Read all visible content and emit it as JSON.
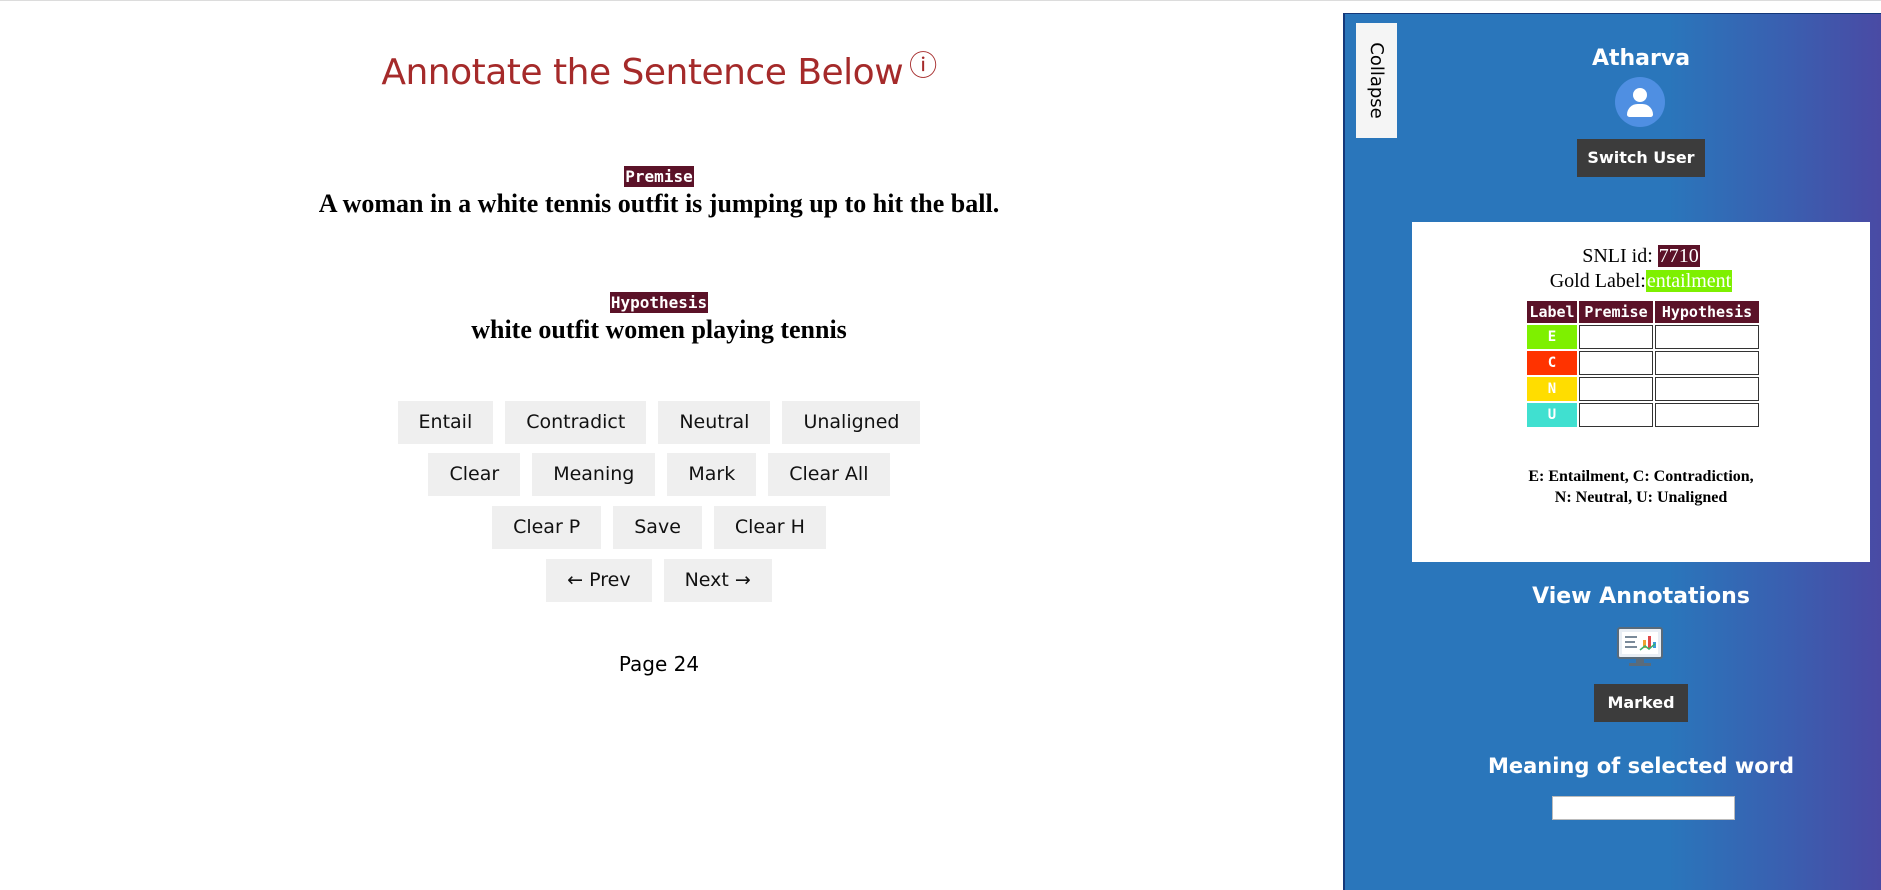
{
  "main": {
    "title": "Annotate the Sentence Below",
    "info_icon": "ⓘ",
    "premise_tag": "Premise",
    "premise": "A woman in a white tennis outfit is jumping up to hit the ball.",
    "hypothesis_tag": "Hypothesis",
    "hypothesis": "white outfit women playing tennis",
    "buttons": {
      "entail": "Entail",
      "contradict": "Contradict",
      "neutral": "Neutral",
      "unaligned": "Unaligned",
      "clear": "Clear",
      "meaning": "Meaning",
      "mark": "Mark",
      "clear_all": "Clear All",
      "clear_p": "Clear P",
      "save": "Save",
      "clear_h": "Clear H",
      "prev": "← Prev",
      "next": "Next →"
    },
    "page": "Page 24"
  },
  "sidebar": {
    "collapse": "Collapse",
    "user": "Atharva",
    "switch_user": "Switch User",
    "snli_label": "SNLI id:",
    "snli_id": "7710",
    "gold_label": "Gold Label:",
    "gold_value": "entailment",
    "table": {
      "headers": [
        "Label",
        "Premise",
        "Hypothesis"
      ],
      "rows": [
        {
          "label": "E",
          "color": "#7ef000"
        },
        {
          "label": "C",
          "color": "#ff3300"
        },
        {
          "label": "N",
          "color": "#ffdd00"
        },
        {
          "label": "U",
          "color": "#40e0d0"
        }
      ]
    },
    "legend_1": "E: Entailment, C: Contradiction,",
    "legend_2": "N: Neutral, U: Unaligned",
    "view_annotations": "View Annotations",
    "marked": "Marked",
    "meaning_heading": "Meaning of selected word",
    "meaning_value": ""
  },
  "colors": {
    "title": "#a52a2a",
    "tag_bg": "#5b1228",
    "sidebar_bg": "#2a76bb"
  }
}
